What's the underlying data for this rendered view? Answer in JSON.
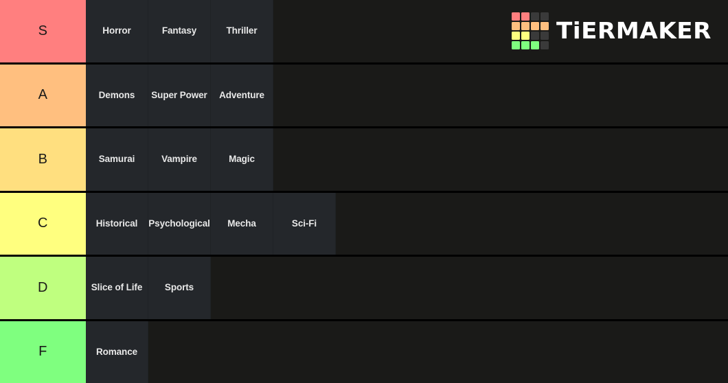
{
  "app": {
    "name": "TierMaker",
    "wordmark": "TiERMAKER"
  },
  "logo": {
    "name": "tiermaker-logo",
    "grid_colors": [
      [
        "#FF7F7F",
        "#FF7F7F",
        "#3a3a3a",
        "#3a3a3a"
      ],
      [
        "#FFBF7F",
        "#FFBF7F",
        "#FFBF7F",
        "#FFBF7F"
      ],
      [
        "#FFFF7F",
        "#FFFF7F",
        "#3a3a3a",
        "#3a3a3a"
      ],
      [
        "#7FFF7F",
        "#7FFF7F",
        "#7FFF7F",
        "#3a3a3a"
      ]
    ]
  },
  "colors": {
    "row_background": "#1a1a18",
    "tile_background": "#24272b",
    "separator": "#000000",
    "tile_text": "#e8e8e8",
    "label_text": "#1a1a18"
  },
  "tiers": [
    {
      "label": "S",
      "color": "#FF7F7F",
      "items": [
        {
          "label": "Horror"
        },
        {
          "label": "Fantasy"
        },
        {
          "label": "Thriller"
        }
      ]
    },
    {
      "label": "A",
      "color": "#FFBF7F",
      "items": [
        {
          "label": "Demons"
        },
        {
          "label": "Super Power"
        },
        {
          "label": "Adventure"
        }
      ]
    },
    {
      "label": "B",
      "color": "#FFDF7F",
      "items": [
        {
          "label": "Samurai"
        },
        {
          "label": "Vampire"
        },
        {
          "label": "Magic"
        }
      ]
    },
    {
      "label": "C",
      "color": "#FFFF7F",
      "items": [
        {
          "label": "Historical"
        },
        {
          "label": "Psychological"
        },
        {
          "label": "Mecha"
        },
        {
          "label": "Sci-Fi"
        }
      ]
    },
    {
      "label": "D",
      "color": "#BFFF7F",
      "items": [
        {
          "label": "Slice of Life"
        },
        {
          "label": "Sports"
        }
      ]
    },
    {
      "label": "F",
      "color": "#7FFF7F",
      "items": [
        {
          "label": "Romance"
        }
      ]
    }
  ]
}
